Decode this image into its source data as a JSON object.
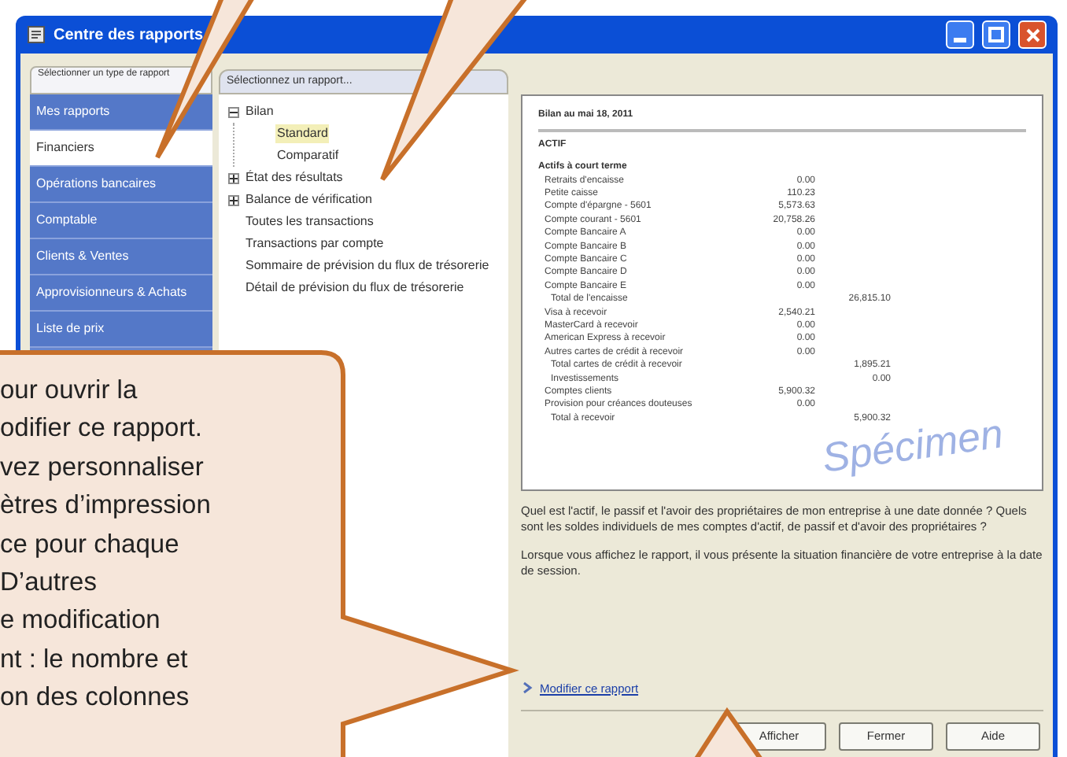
{
  "window": {
    "title": "Centre des rapports"
  },
  "tabs": [
    {
      "label": "Sélectionner un type de rapport"
    },
    {
      "label": "Sélectionnez un rapport..."
    }
  ],
  "sidebar": {
    "items": [
      {
        "label": "Mes rapports",
        "selected": false
      },
      {
        "label": "Financiers",
        "selected": true
      },
      {
        "label": "Opérations bancaires",
        "selected": false
      },
      {
        "label": "Comptable",
        "selected": false
      },
      {
        "label": "Clients & Ventes",
        "selected": false
      },
      {
        "label": "Approvisionneurs & Achats",
        "selected": false
      },
      {
        "label": "Liste de prix",
        "selected": false
      }
    ]
  },
  "tree": [
    {
      "label": "Bilan",
      "expanded": true,
      "selected": false,
      "children": [
        {
          "label": "Standard",
          "selected": true
        },
        {
          "label": "Comparatif",
          "selected": false
        }
      ]
    },
    {
      "label": "État des résultats",
      "expanded": false,
      "selected": false
    },
    {
      "label": "Balance de vérification",
      "expanded": false,
      "selected": false
    },
    {
      "label": "Toutes les transactions",
      "selected": false
    },
    {
      "label": "Transactions par compte",
      "selected": false
    },
    {
      "label": "Sommaire de prévision du flux de trésorerie",
      "selected": false
    },
    {
      "label": "Détail de prévision du flux de trésorerie",
      "selected": false
    }
  ],
  "preview": {
    "title": "Bilan au mai 18, 2011",
    "section": "ACTIF",
    "group": "Actifs à court terme",
    "stamp": "Spécimen",
    "rows": [
      {
        "label": "Retraits d'encaisse",
        "amount": "0.00"
      },
      {
        "label": "Petite caisse",
        "amount": "110.23"
      },
      {
        "label": "Compte d'épargne - 5601",
        "amount": "5,573.63"
      },
      {
        "label": "Compte courant - 5601",
        "amount": "20,758.26"
      },
      {
        "label": "Compte Bancaire A",
        "amount": "0.00"
      },
      {
        "label": "Compte Bancaire B",
        "amount": "0.00"
      },
      {
        "label": "Compte Bancaire C",
        "amount": "0.00"
      },
      {
        "label": "Compte Bancaire D",
        "amount": "0.00"
      },
      {
        "label": "Compte Bancaire E",
        "amount": "0.00"
      },
      {
        "label": "Total de l'encaisse",
        "total": "26,815.10"
      },
      {
        "label": "Visa à recevoir",
        "amount": "2,540.21"
      },
      {
        "label": "MasterCard à recevoir",
        "amount": "0.00"
      },
      {
        "label": "American Express à recevoir",
        "amount": "0.00"
      },
      {
        "label": "Autres cartes de crédit à recevoir",
        "amount": "0.00"
      },
      {
        "label": "Total cartes de crédit à recevoir",
        "total": "1,895.21"
      },
      {
        "label": "Investissements",
        "total": "0.00"
      },
      {
        "label": "Comptes clients",
        "amount": "5,900.32"
      },
      {
        "label": "Provision pour créances douteuses",
        "amount": "0.00"
      },
      {
        "label": "Total à recevoir",
        "total": "5,900.32"
      }
    ]
  },
  "description": [
    "Quel est l'actif, le passif et l'avoir des propriétaires de mon entreprise à une date donnée ? Quels sont les soldes individuels de mes comptes d'actif, de passif et d'avoir des propriétaires ?",
    "Lorsque vous affichez le rapport, il vous présente la situation financière de votre entreprise à la date de session."
  ],
  "link": "Modifier ce rapport",
  "buttons": [
    "Afficher",
    "Fermer",
    "Aide"
  ],
  "callout": {
    "lines": [
      "our ouvrir la",
      "odifier ce rapport.",
      "vez personnaliser",
      "ètres d’impression",
      "ce pour chaque",
      "D’autres",
      "e modification",
      "nt : le nombre et",
      "on des colonnes"
    ]
  }
}
